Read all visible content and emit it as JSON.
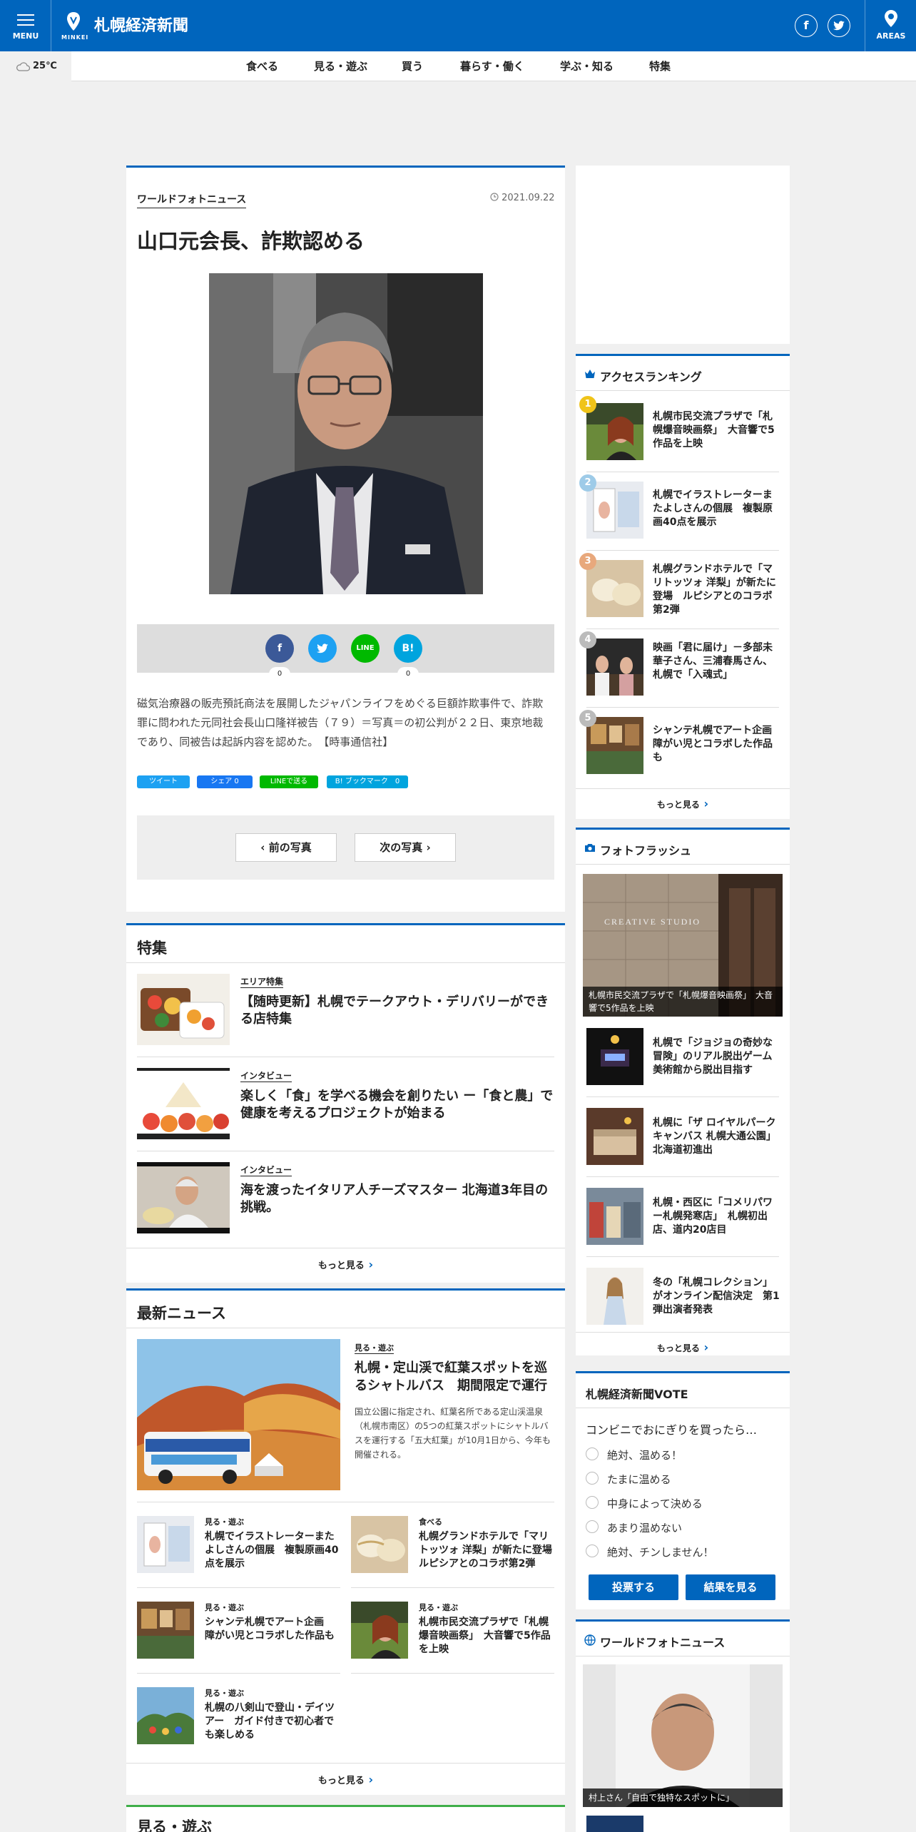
{
  "header": {
    "menu_label": "MENU",
    "logo_sub": "MINKEI",
    "site_name": "札幌経済新聞",
    "areas_label": "AREAS"
  },
  "weather": {
    "temp": "25℃",
    "icon": "cloud-icon"
  },
  "nav": [
    "食べる",
    "見る・遊ぶ",
    "買う",
    "暮らす・働く",
    "学ぶ・知る",
    "特集"
  ],
  "article": {
    "category": "ワールドフォトニュース",
    "date": "2021.09.22",
    "title": "山口元会長、詐欺認める",
    "share": {
      "line": "LINE",
      "hatena": "B!",
      "fb_count": "0",
      "hatena_count": "0"
    },
    "body": "磁気治療器の販売預託商法を展開したジャパンライフをめぐる巨額詐欺事件で、詐欺罪に問われた元同社会長山口隆祥被告（７９）＝写真＝の初公判が２２日、東京地裁であり、同被告は起訴内容を認めた。　【時事通信社】",
    "mini_share": [
      "ツイート",
      "シェア 0",
      "LINEで送る",
      "B! ブックマーク　0"
    ],
    "prev": "前の写真",
    "next": "次の写真"
  },
  "features": {
    "title": "特集",
    "items": [
      {
        "tag": "エリア特集",
        "title": "【随時更新】札幌でテークアウト・デリバリーができる店特集"
      },
      {
        "tag": "インタビュー",
        "title": "楽しく「食」を学べる機会を創りたい ー「食と農」で健康を考えるプロジェクトが始まる"
      },
      {
        "tag": "インタビュー",
        "title": "海を渡ったイタリア人チーズマスター 北海道3年目の挑戦。"
      }
    ],
    "more": "もっと見る"
  },
  "latest": {
    "title": "最新ニュース",
    "lead": {
      "tag": "見る・遊ぶ",
      "title": "札幌・定山渓で紅葉スポットを巡るシャトルバス　期間限定で運行",
      "desc": "国立公園に指定され、紅葉名所である定山渓温泉（札幌市南区）の5つの紅葉スポットにシャトルバスを運行する「五大紅葉」が10月1日から、今年も開催される。"
    },
    "items": [
      {
        "tag": "見る・遊ぶ",
        "title": "札幌でイラストレーターまたよしさんの個展　複製原画40点を展示"
      },
      {
        "tag": "食べる",
        "title": "札幌グランドホテルで「マリトッツォ 洋梨」が新たに登場　ルピシアとのコラボ第2弾"
      },
      {
        "tag": "見る・遊ぶ",
        "title": "シャンテ札幌でアート企画　障がい児とコラボした作品も"
      },
      {
        "tag": "見る・遊ぶ",
        "title": "札幌市民交流プラザで「札幌爆音映画祭」　大音響で5作品を上映"
      },
      {
        "tag": "見る・遊ぶ",
        "title": "札幌の八剣山で登山・デイツアー　ガイド付きで初心者でも楽しめる"
      }
    ],
    "more": "もっと見る"
  },
  "next_section": {
    "title": "見る・遊ぶ"
  },
  "ranking": {
    "title": "アクセスランキング",
    "items": [
      {
        "rank": "1",
        "title": "札幌市民交流プラザで「札幌爆音映画祭」　大音響で5作品を上映"
      },
      {
        "rank": "2",
        "title": "札幌でイラストレーターまたよしさんの個展　複製原画40点を展示"
      },
      {
        "rank": "3",
        "title": "札幌グランドホテルで「マリトッツォ 洋梨」が新たに登場　ルピシアとのコラボ第2弾"
      },
      {
        "rank": "4",
        "title": "映画「君に届け」－多部未華子さん、三浦春馬さん、札幌で「入魂式」"
      },
      {
        "rank": "5",
        "title": "シャンテ札幌でアート企画　障がい児とコラボした作品も"
      }
    ],
    "more": "もっと見る"
  },
  "photoflash": {
    "title": "フォトフラッシュ",
    "lead_caption": "札幌市民交流プラザで「札幌爆音映画祭」　大音響で5作品を上映",
    "lead_sign": "CREATIVE STUDIO",
    "items": [
      "札幌で「ジョジョの奇妙な冒険」のリアル脱出ゲーム　美術館から脱出目指す",
      "札幌に「ザ ロイヤルパークキャンバス 札幌大通公園」　北海道初進出",
      "札幌・西区に「コメリパワー札幌発寒店」　札幌初出店、道内20店目",
      "冬の「札幌コレクション」がオンライン配信決定　第1弾出演者発表"
    ],
    "more": "もっと見る"
  },
  "vote": {
    "title": "札幌経済新聞VOTE",
    "question": "コンビニでおにぎりを買ったら…",
    "options": [
      "絶対、温める！",
      "たまに温める",
      "中身によって決める",
      "あまり温めない",
      "絶対、チンしません！"
    ],
    "submit": "投票する",
    "results": "結果を見る"
  },
  "world_photo": {
    "title": "ワールドフォトニュース",
    "caption": "村上さん「自由で独特なスポットに」"
  },
  "colors": {
    "brand": "#0065bd",
    "rank1": "#f0c419",
    "rank2": "#9ecbe8",
    "rank3": "#e8a87c",
    "rank4": "#bbbbbb",
    "rank5": "#bbbbbb"
  }
}
